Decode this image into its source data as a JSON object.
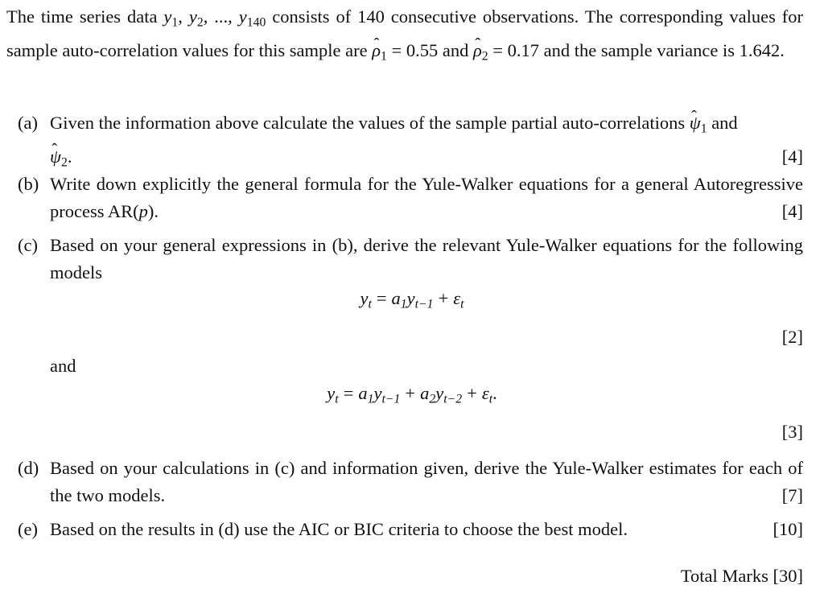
{
  "intro": {
    "text_1": "The time series data ",
    "series_var": "y",
    "series_subs": [
      "1",
      "2",
      "140"
    ],
    "ellipsis": "...",
    "text_2": " consists of 140 consecutive observations.  The corresponding values for sample auto-correlation values for this sample are ",
    "rho_symbol": "ρ",
    "rho1_sub": "1",
    "rho1_value": "0.55",
    "and_word": " and ",
    "rho2_sub": "2",
    "rho2_value": "0.17",
    "text_3": " and the sample variance is 1.642."
  },
  "questions": [
    {
      "label": "(a)",
      "text_1": "Given the information above calculate the values of the sample partial auto-correlations ",
      "psi_symbol": "ψ",
      "psi1_sub": "1",
      "and_word": " and",
      "psi2_sub": "2",
      "text_end": ".",
      "marks": "[4]"
    },
    {
      "label": "(b)",
      "text": "Write down explicitly the general formula for the Yule-Walker equations for a general Autoregressive process AR(",
      "param": "p",
      "text_end": ").",
      "marks": "[4]"
    },
    {
      "label": "(c)",
      "text": "Based on your general expressions in (b), derive the relevant Yule-Walker equations for the following models",
      "equation_1": {
        "lhs": "y",
        "lhs_sub": "t",
        "eq": "=",
        "t1_coef": "a",
        "t1_coef_sub": "1",
        "t1_var": "y",
        "t1_var_sub": "t−1",
        "plus": "+",
        "err": "ε",
        "err_sub": "t",
        "end": ""
      },
      "marks_1": "[2]",
      "connector": "and",
      "equation_2": {
        "lhs": "y",
        "lhs_sub": "t",
        "eq": "=",
        "t1_coef": "a",
        "t1_coef_sub": "1",
        "t1_var": "y",
        "t1_var_sub": "t−1",
        "t2_coef": "a",
        "t2_coef_sub": "2",
        "t2_var": "y",
        "t2_var_sub": "t−2",
        "plus": "+",
        "err": "ε",
        "err_sub": "t",
        "end": "."
      },
      "marks_2": "[3]"
    },
    {
      "label": "(d)",
      "text": "Based on your calculations in (c) and information given, derive the Yule-Walker estimates for each of the two models.",
      "marks": "[7]"
    },
    {
      "label": "(e)",
      "text": "Based on the results in (d) use the AIC or BIC criteria to choose the best model.",
      "marks": "[10]"
    }
  ],
  "total": "Total Marks [30]"
}
